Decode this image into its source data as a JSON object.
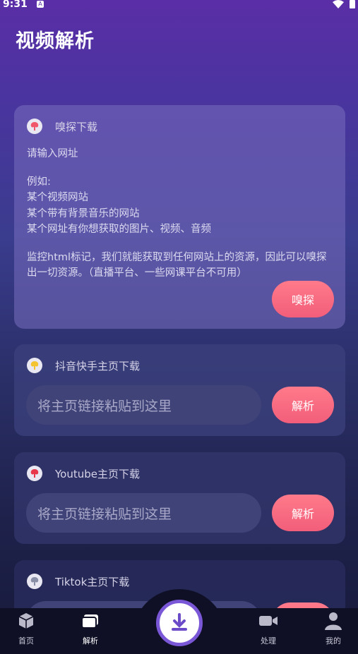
{
  "status_bar": {
    "time": "9:31",
    "badge": "A"
  },
  "page": {
    "title": "视频解析"
  },
  "sniff_card": {
    "title": "嗅探下载",
    "prompt": "请输入网址",
    "example_heading": "例如:",
    "examples": [
      "某个视频网站",
      "某个带有背景音乐的网站",
      "某个网址有你想获取的图片、视频、音频"
    ],
    "description": "监控html标记，我们就能获取到任何网站上的资源，因此可以嗅探出一切资源。（直播平台、一些网课平台不可用）",
    "button_label": "嗅探"
  },
  "douyin_card": {
    "title": "抖音快手主页下载",
    "placeholder": "将主页链接粘贴到这里",
    "button_label": "解析"
  },
  "youtube_card": {
    "title": "Youtube主页下载",
    "placeholder": "将主页链接粘贴到这里",
    "button_label": "解析"
  },
  "tiktok_card": {
    "title": "Tiktok主页下载"
  },
  "bottom_nav": {
    "home": "首页",
    "parse": "解析",
    "process": "处理",
    "mine": "我的"
  }
}
